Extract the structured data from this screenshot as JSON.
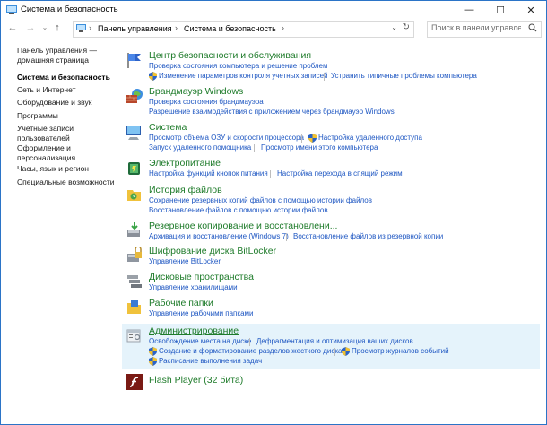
{
  "window": {
    "title": "Система и безопасность",
    "minimize_glyph": "—",
    "maximize_glyph": "☐",
    "close_glyph": "✕"
  },
  "addressbar": {
    "back_glyph": "←",
    "forward_glyph": "→",
    "dropdown_glyph": "⌄",
    "up_glyph": "↑",
    "breadcrumbs": [
      "Панель управления",
      "Система и безопасность"
    ],
    "separator": "›",
    "refresh_glyph": "↻",
    "search_placeholder": "Поиск в панели управления"
  },
  "sidebar": {
    "items": [
      {
        "label": "Панель управления —"
      },
      {
        "label": "домашняя страница"
      },
      {
        "label": "Система и безопасность",
        "active": true
      },
      {
        "label": "Сеть и Интернет"
      },
      {
        "label": "Оборудование и звук"
      },
      {
        "label": "Программы"
      },
      {
        "label": "Учетные записи"
      },
      {
        "label": "пользователей"
      },
      {
        "label": "Оформление и"
      },
      {
        "label": "персонализация"
      },
      {
        "label": "Часы, язык и регион"
      },
      {
        "label": "Специальные возможности"
      }
    ]
  },
  "categories": [
    {
      "title": "Центр безопасности и обслуживания",
      "icon": "flag-icon",
      "lines": [
        [
          "Проверка состояния компьютера и решение проблем"
        ],
        [
          "Изменение параметров контроля учетных записей",
          "Устранить типичные проблемы компьютера"
        ]
      ]
    },
    {
      "title": "Брандмауэр Windows",
      "icon": "firewall-icon",
      "lines": [
        [
          "Проверка состояния брандмауэра"
        ],
        [
          "Разрешение взаимодействия с приложением через брандмауэр Windows"
        ]
      ]
    },
    {
      "title": "Система",
      "icon": "computer-icon",
      "lines": [
        [
          "Просмотр объема ОЗУ и скорости процессора",
          "Настройка удаленного доступа"
        ],
        [
          "Запуск удаленного помощника",
          "Просмотр имени этого компьютера"
        ]
      ]
    },
    {
      "title": "Электропитание",
      "icon": "power-icon",
      "lines": [
        [
          "Настройка функций кнопок питания",
          "Настройка перехода в спящий режим"
        ]
      ]
    },
    {
      "title": "История файлов",
      "icon": "file-history-icon",
      "lines": [
        [
          "Сохранение резервных копий файлов с помощью истории файлов"
        ],
        [
          "Восстановление файлов с помощью истории файлов"
        ]
      ]
    },
    {
      "title": "Резервное копирование и восстановлени...",
      "icon": "backup-icon",
      "lines": [
        [
          "Архивация и восстановление (Windows 7)",
          "Восстановление файлов из резервной копии"
        ]
      ]
    },
    {
      "title": "Шифрование диска BitLocker",
      "icon": "bitlocker-icon",
      "lines": [
        [
          "Управление BitLocker"
        ]
      ]
    },
    {
      "title": "Дисковые пространства",
      "icon": "storage-spaces-icon",
      "lines": [
        [
          "Управление хранилищами"
        ]
      ]
    },
    {
      "title": "Рабочие папки",
      "icon": "work-folders-icon",
      "lines": [
        [
          "Управление рабочими папками"
        ]
      ]
    },
    {
      "title": "Администрирование",
      "icon": "admin-tools-icon",
      "lines": [
        [
          "Освобождение места на диске",
          "Дефрагментация и оптимизация ваших дисков"
        ],
        [
          "Создание и форматирование разделов жесткого диска",
          "Просмотр журналов событий"
        ],
        [
          "Расписание выполнения задач"
        ]
      ]
    },
    {
      "title": "Flash Player (32 бита)",
      "icon": "flash-icon",
      "lines": []
    }
  ],
  "colors": {
    "category_title": "#1e7b2a",
    "link": "#1d56c2",
    "highlight": "#e5f3fb",
    "window_border": "#2b74c7"
  }
}
